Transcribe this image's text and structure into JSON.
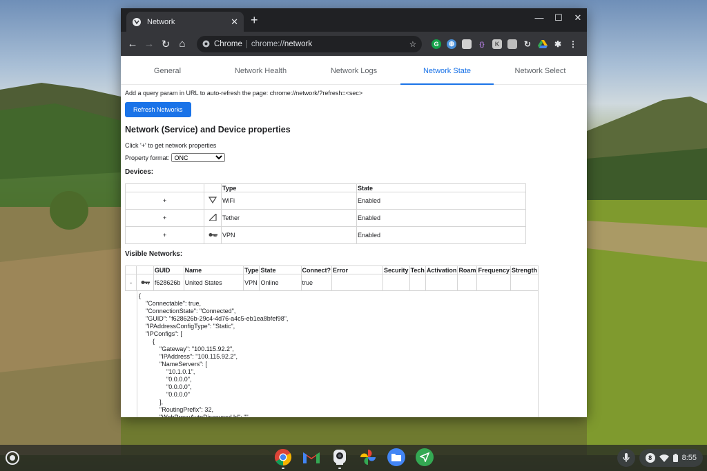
{
  "browser": {
    "tab_title": "Network",
    "new_tab": "+",
    "tab_close": "✕",
    "window_controls": {
      "minimize": "—",
      "maximize": "☐",
      "close": "✕"
    },
    "omnibox": {
      "site_chip": "Chrome",
      "url_scheme": "chrome://",
      "url_host": "network"
    },
    "icons": [
      "back-icon",
      "forward-icon",
      "reload-icon",
      "home-icon",
      "star-icon",
      "extensions-icon",
      "menu-icon"
    ]
  },
  "page": {
    "tabs": [
      {
        "label": "General"
      },
      {
        "label": "Network Health"
      },
      {
        "label": "Network Logs"
      },
      {
        "label": "Network State",
        "active": true
      },
      {
        "label": "Network Select"
      }
    ],
    "hint": "Add a query param in URL to auto-refresh the page: chrome://network/?refresh=<sec>",
    "refresh_button": "Refresh Networks",
    "heading": "Network (Service) and Device properties",
    "click_hint": "Click '+' to get network properties",
    "property_format_label": "Property format:",
    "property_format_value": "ONC",
    "devices_heading": "Devices:",
    "devices_table": {
      "headers": [
        "",
        "",
        "Type",
        "State"
      ],
      "rows": [
        {
          "toggle": "+",
          "icon": "wifi-icon",
          "type": "WiFi",
          "state": "Enabled"
        },
        {
          "toggle": "+",
          "icon": "cellular-icon",
          "type": "Tether",
          "state": "Enabled"
        },
        {
          "toggle": "+",
          "icon": "vpn-key-icon",
          "type": "VPN",
          "state": "Enabled"
        }
      ]
    },
    "visible_heading": "Visible Networks:",
    "networks_table": {
      "headers": [
        "",
        "",
        "GUID",
        "Name",
        "Type",
        "State",
        "Connect?",
        "Error",
        "Security",
        "Tech",
        "Activation",
        "Roam",
        "Frequency",
        "Strength"
      ],
      "row": {
        "toggle": "-",
        "icon": "vpn-key-icon",
        "guid": "f628626b",
        "name": "United States",
        "type": "VPN",
        "state": "Online",
        "connect": "true"
      }
    },
    "json_properties": "{\n\t\"Connectable\": true,\n\t\"ConnectionState\": \"Connected\",\n\t\"GUID\": \"f628626b-29c4-4d76-a4c5-eb1ea8bfef98\",\n\t\"IPAddressConfigType\": \"Static\",\n\t\"IPConfigs\": [\n\t\t{\n\t\t\t\"Gateway\": \"100.115.92.2\",\n\t\t\t\"IPAddress\": \"100.115.92.2\",\n\t\t\t\"NameServers\": [\n\t\t\t\t\"10.1.0.1\",\n\t\t\t\t\"0.0.0.0\",\n\t\t\t\t\"0.0.0.0\",\n\t\t\t\t\"0.0.0.0\"\n\t\t\t],\n\t\t\t\"RoutingPrefix\": 32,\n\t\t\t\"WebProxyAutoDiscoveryUrl\": \"\"\n\t\t},"
  },
  "shelf": {
    "apps": [
      "chrome-icon",
      "gmail-icon",
      "camera-icon",
      "photos-icon",
      "files-icon",
      "send-icon"
    ],
    "notification_count": "8",
    "time": "8:55"
  },
  "colors": {
    "accent": "#1a73e8",
    "titlebar": "#202124",
    "toolbar": "#35363a"
  }
}
